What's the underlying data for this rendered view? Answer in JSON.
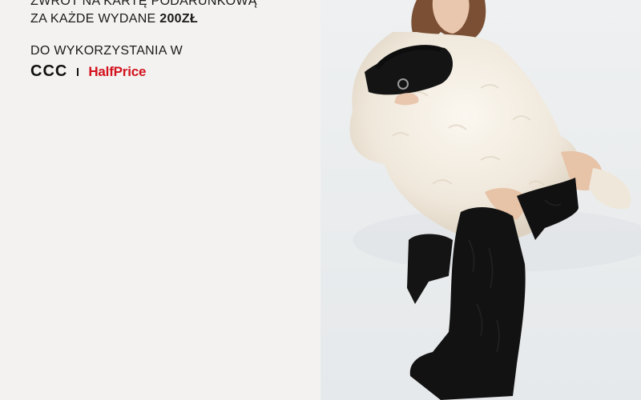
{
  "promo": {
    "line1": "ZWROT NA KARTĘ PODARUNKOWĄ",
    "line2_prefix": "ZA KAŻDE WYDANE ",
    "line2_amount": "200ZŁ",
    "line3": "DO WYKORZYSTANIA W",
    "brand_ccc": "CCC",
    "brand_halfprice": "HalfPrice"
  },
  "colors": {
    "halfprice_red": "#d3121e",
    "text": "#1a1a1a",
    "left_bg": "#f3f2f0",
    "photo_bg": "#eceeef"
  }
}
